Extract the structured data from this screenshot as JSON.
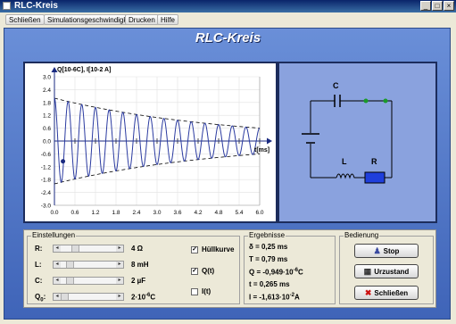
{
  "window": {
    "title": "RLC-Kreis",
    "buttons": [
      "_",
      "□",
      "×"
    ]
  },
  "menu": [
    "Schließen",
    "Simulationsgeschwindigkeit",
    "Drucken",
    "Hilfe"
  ],
  "heading": "RLC-Kreis",
  "plot": {
    "ylabel": "Q[10-6C], I[10-2 A]",
    "xlabel": "t[ms]",
    "yticks": [
      "3.0",
      "2.4",
      "1.8",
      "1.2",
      "0.6",
      "0.0",
      "-0.6",
      "-1.2",
      "-1.8",
      "-2.4",
      "-3.0"
    ],
    "xticks": [
      "0.0",
      "0.6",
      "1.2",
      "1.8",
      "2.4",
      "3.0",
      "3.6",
      "4.2",
      "4.8",
      "5.4",
      "6.0"
    ]
  },
  "chart_data": {
    "type": "line",
    "xlabel": "t[ms]",
    "ylabel": "Q[10-6C], I[10-2 A]",
    "xlim": [
      0,
      6.0
    ],
    "ylim": [
      -3.0,
      3.0
    ],
    "series": [
      {
        "name": "Q(t)",
        "amplitude": 2.0,
        "damping_time_ms": 5.0,
        "period_ms": 0.4,
        "style": "solid",
        "color": "#2a3aa0"
      },
      {
        "name": "Hüllkurve",
        "style": "dashed",
        "color": "#000000"
      }
    ],
    "marker": {
      "t": 0.25,
      "q": -0.949
    }
  },
  "circuit": {
    "C": "C",
    "L": "L",
    "R": "R"
  },
  "settings": {
    "title": "Einstellungen",
    "rows": [
      {
        "label": "R:",
        "value": "4 Ω",
        "pos": 0.2
      },
      {
        "label": "L:",
        "value": "8 mH",
        "pos": 0.1
      },
      {
        "label": "C:",
        "value": "2 µF",
        "pos": 0.1
      },
      {
        "label": "Q",
        "sub": "0",
        "label_suffix": ":",
        "value": "2·10",
        "exp": "-6",
        "unit": "C",
        "pos": 0.0
      }
    ],
    "checks": [
      {
        "label": "Hüllkurve",
        "checked": true
      },
      {
        "label": "Q(t)",
        "checked": true
      },
      {
        "label": "I(t)",
        "checked": false
      }
    ]
  },
  "results": {
    "title": "Ergebnisse",
    "rows": [
      {
        "name": "δ",
        "value": "0,25 ms"
      },
      {
        "name": "T",
        "value": "0,79 ms"
      },
      {
        "name": "Q",
        "value": "-0,949·10",
        "exp": "-6",
        "unit": "C"
      },
      {
        "name": "t",
        "value": "0,265 ms"
      },
      {
        "name": "I",
        "value": "-1,613·10",
        "exp": "-2",
        "unit": "A"
      }
    ]
  },
  "control": {
    "title": "Bedienung",
    "buttons": [
      {
        "label": "Stop",
        "icon": "stop-icon",
        "glyph": "♟",
        "color": "#3a4aa0"
      },
      {
        "label": "Urzustand",
        "icon": "reset-icon",
        "glyph": "▦",
        "color": "#333333"
      },
      {
        "label": "Schließen",
        "icon": "close-icon",
        "glyph": "✖",
        "color": "#cc1111"
      }
    ]
  }
}
